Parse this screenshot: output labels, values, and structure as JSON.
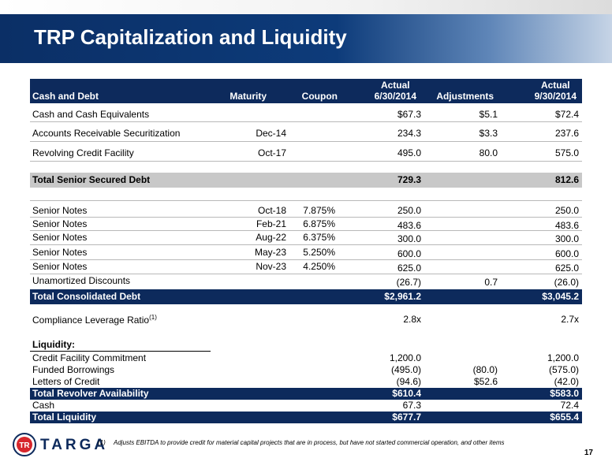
{
  "title": "TRP Capitalization and Liquidity",
  "header": {
    "col1": "Cash and Debt",
    "col2": "Maturity",
    "col3": "Coupon",
    "col4_line1": "Actual",
    "col4_line2": "6/30/2014",
    "col5": "Adjustments",
    "col6_line1": "Actual",
    "col6_line2": "9/30/2014"
  },
  "rows": [
    {
      "label": "Cash and Cash Equivalents",
      "maturity": "",
      "coupon": "",
      "a1": "$67.3",
      "adj": "$5.1",
      "a2": "$72.4"
    },
    {
      "label": "Accounts Receivable Securitization",
      "maturity": "Dec-14",
      "coupon": "",
      "a1": "234.3",
      "adj": "$3.3",
      "a2": "237.6"
    },
    {
      "label": "Revolving Credit Facility",
      "maturity": "Oct-17",
      "coupon": "",
      "a1": "495.0",
      "adj": "80.0",
      "a2": "575.0"
    },
    {
      "label": "Total Senior Secured Debt",
      "maturity": "",
      "coupon": "",
      "a1": "729.3",
      "adj": "",
      "a2": "812.6"
    },
    {
      "label": "Senior Notes",
      "maturity": "Oct-18",
      "coupon": "7.875%",
      "a1": "250.0",
      "adj": "",
      "a2": "250.0"
    },
    {
      "label": "Senior Notes",
      "maturity": "Feb-21",
      "coupon": "6.875%",
      "a1": "483.6",
      "adj": "",
      "a2": "483.6"
    },
    {
      "label": "Senior Notes",
      "maturity": "Aug-22",
      "coupon": "6.375%",
      "a1": "300.0",
      "adj": "",
      "a2": "300.0"
    },
    {
      "label": "Senior Notes",
      "maturity": "May-23",
      "coupon": "5.250%",
      "a1": "600.0",
      "adj": "",
      "a2": "600.0"
    },
    {
      "label": "Senior Notes",
      "maturity": "Nov-23",
      "coupon": "4.250%",
      "a1": "625.0",
      "adj": "",
      "a2": "625.0"
    },
    {
      "label": "Unamortized Discounts",
      "maturity": "",
      "coupon": "",
      "a1": "(26.7)",
      "adj": "0.7",
      "a2": "(26.0)"
    },
    {
      "label": "Total Consolidated Debt",
      "maturity": "",
      "coupon": "",
      "a1": "$2,961.2",
      "adj": "",
      "a2": "$3,045.2"
    },
    {
      "label": "Compliance Leverage Ratio",
      "sup": "(1)",
      "maturity": "",
      "coupon": "",
      "a1": "2.8x",
      "adj": "",
      "a2": "2.7x"
    }
  ],
  "liquidity": {
    "heading": "Liquidity:",
    "rows": [
      {
        "label": "Credit Facility Commitment",
        "a1": "1,200.0",
        "adj": "",
        "a2": "1,200.0"
      },
      {
        "label": "Funded Borrowings",
        "a1": "(495.0)",
        "adj": "(80.0)",
        "a2": "(575.0)"
      },
      {
        "label": "Letters of Credit",
        "a1": "(94.6)",
        "adj": "$52.6",
        "a2": "(42.0)"
      },
      {
        "label": "Total Revolver Availability",
        "a1": "$610.4",
        "adj": "",
        "a2": "$583.0"
      },
      {
        "label": "Cash",
        "a1": "67.3",
        "adj": "",
        "a2": "72.4"
      },
      {
        "label": "Total Liquidity",
        "a1": "$677.7",
        "adj": "",
        "a2": "$655.4"
      }
    ]
  },
  "footnote": {
    "num": "(1)",
    "text": "Adjusts EBITDA to provide credit for material capital projects that are in process, but have not started commercial operation, and other items"
  },
  "logo": {
    "word": "TARGA",
    "mark": "TR"
  },
  "page_number": "17",
  "colors": {
    "navy": "#0d2a5c",
    "grey": "#c8c8c8"
  }
}
